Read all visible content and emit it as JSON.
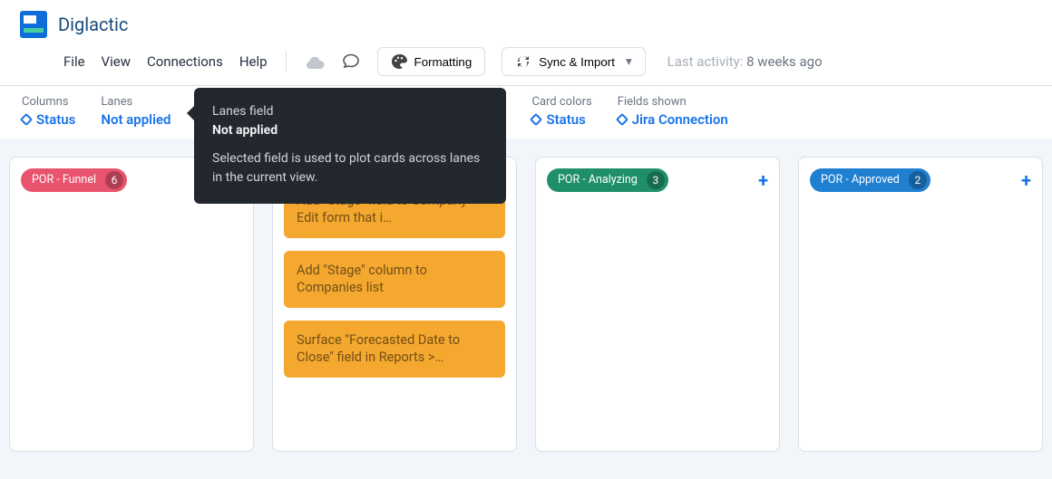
{
  "app": {
    "name": "Diglactic"
  },
  "menu": {
    "file": "File",
    "view": "View",
    "connections": "Connections",
    "help": "Help",
    "formatting": "Formatting",
    "sync_import": "Sync & Import",
    "last_activity_label": "Last activity:",
    "last_activity_value": "8 weeks ago"
  },
  "config": {
    "columns": {
      "label": "Columns",
      "value": "Status"
    },
    "lanes": {
      "label": "Lanes",
      "value": "Not applied"
    },
    "card_colors": {
      "label": "Card colors",
      "value": "Status"
    },
    "fields_shown": {
      "label": "Fields shown",
      "value": "Jira Connection"
    }
  },
  "tooltip": {
    "label": "Lanes field",
    "value": "Not applied",
    "body": "Selected field is used to plot cards across lanes in the current view."
  },
  "columns": [
    {
      "title": "POR - Funnel",
      "count": "6",
      "pill_class": "red",
      "show_plus": false,
      "cards": []
    },
    {
      "title": "",
      "count": "",
      "pill_class": "",
      "show_plus": false,
      "cards": [
        "Add \"Stage\" field to Company > Edit form that i…",
        "Add \"Stage\" column to Companies list",
        "Surface \"Forecasted Date to Close\" field in Reports >…"
      ]
    },
    {
      "title": "POR - Analyzing",
      "count": "3",
      "pill_class": "green",
      "show_plus": true,
      "cards": []
    },
    {
      "title": "POR - Approved",
      "count": "2",
      "pill_class": "blue",
      "show_plus": true,
      "cards": []
    }
  ]
}
